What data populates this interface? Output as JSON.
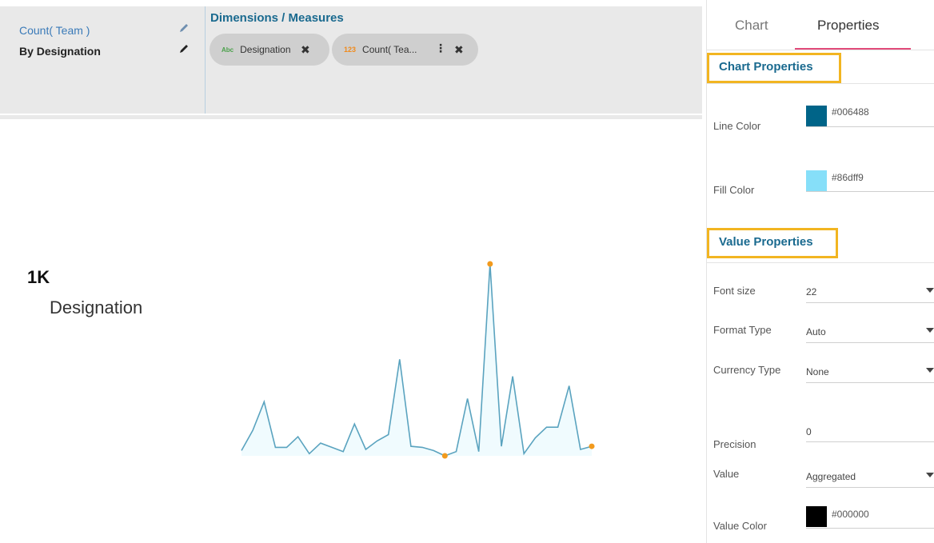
{
  "designer": {
    "title_primary": "Count( Team )",
    "title_secondary": "By Designation",
    "dimensions_label": "Dimensions / Measures",
    "chips": [
      {
        "badge": "Abc",
        "label": "Designation"
      },
      {
        "badge": "123",
        "label": "Count( Tea..."
      }
    ]
  },
  "kpi": {
    "value": "1K",
    "label": "Designation"
  },
  "colors": {
    "line": "#006488",
    "fill": "#86dff9",
    "marker": "#f29a1d",
    "value_color": "#000000"
  },
  "chart_data": {
    "type": "area",
    "values": [
      3,
      22,
      49,
      6,
      6,
      16,
      0,
      10,
      6,
      2,
      28,
      4,
      12,
      18,
      89,
      7,
      6,
      3,
      -2,
      2,
      52,
      2,
      179,
      7,
      73,
      0,
      15,
      25,
      25,
      64,
      4,
      7
    ],
    "highlighted_points": [
      {
        "index": 18,
        "label": "min"
      },
      {
        "index": 22,
        "label": "max"
      },
      {
        "index": 31,
        "label": "last"
      }
    ]
  },
  "properties": {
    "tabs": [
      "Chart",
      "Properties"
    ],
    "active_tab": "Properties",
    "chart_section": "Chart Properties",
    "value_section": "Value Properties",
    "line_color_label": "Line Color",
    "line_color_value": "#006488",
    "fill_color_label": "Fill Color",
    "fill_color_value": "#86dff9",
    "font_size_label": "Font size",
    "font_size_value": "22",
    "format_type_label": "Format Type",
    "format_type_value": "Auto",
    "currency_type_label": "Currency Type",
    "currency_type_value": "None",
    "precision_label": "Precision",
    "precision_value": "0",
    "value_label": "Value",
    "value_value": "Aggregated",
    "value_color_label": "Value Color",
    "value_color_value": "#000000"
  }
}
